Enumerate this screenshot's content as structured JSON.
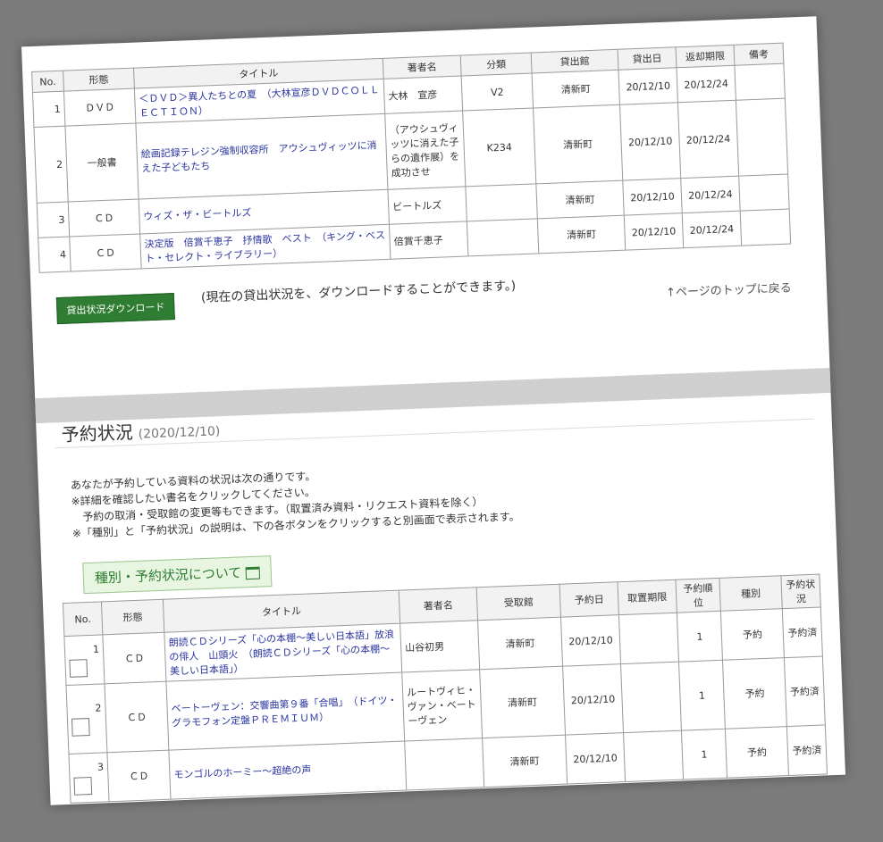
{
  "loan": {
    "headers": [
      "No.",
      "形態",
      "タイトル",
      "著者名",
      "分類",
      "貸出館",
      "貸出日",
      "返却期限",
      "備考"
    ],
    "rows": [
      {
        "no": "1",
        "format": "ＤＶＤ",
        "title": "＜ＤＶＤ＞異人たちとの夏　（大林宣彦ＤＶＤＣＯＬＬＥＣＴＩＯＮ）",
        "author": "大林　宣彦",
        "class": "V2",
        "branch": "清新町",
        "out": "20/12/10",
        "due": "20/12/24",
        "note": ""
      },
      {
        "no": "2",
        "format": "一般書",
        "title": "絵画記録テレジン強制収容所　アウシュヴィッツに消えた子どもたち",
        "author": "（アウシュヴィッツに消えた子らの遺作展）を成功させ",
        "class": "K234",
        "branch": "清新町",
        "out": "20/12/10",
        "due": "20/12/24",
        "note": ""
      },
      {
        "no": "3",
        "format": "ＣＤ",
        "title": "ウィズ・ザ・ビートルズ",
        "author": "ビートルズ",
        "class": "",
        "branch": "清新町",
        "out": "20/12/10",
        "due": "20/12/24",
        "note": ""
      },
      {
        "no": "4",
        "format": "ＣＤ",
        "title": "決定版　倍賞千恵子　抒情歌　ベスト　（キング・ベスト・セレクト・ライブラリー）",
        "author": "倍賞千恵子",
        "class": "",
        "branch": "清新町",
        "out": "20/12/10",
        "due": "20/12/24",
        "note": ""
      }
    ],
    "download_label": "貸出状況ダウンロード",
    "download_note": "(現在の貸出状況を、ダウンロードすることができます。)",
    "pagetop": "↑ページのトップに戻る"
  },
  "reserve": {
    "heading": "予約状況",
    "date": "(2020/12/10)",
    "notes": [
      "あなたが予約している資料の状況は次の通りです。",
      "※詳細を確認したい書名をクリックしてください。",
      "　予約の取消・受取館の変更等もできます。（取置済み資料・リクエスト資料を除く）",
      "※「種別」と「予約状況」の説明は、下の各ボタンをクリックすると別画面で表示されます。"
    ],
    "about_label": "種別・予約状況について",
    "headers": [
      "No.",
      "形態",
      "タイトル",
      "著者名",
      "受取館",
      "予約日",
      "取置期限",
      "予約順位",
      "種別",
      "予約状況"
    ],
    "rows": [
      {
        "no": "1",
        "format": "ＣＤ",
        "title": "朗読ＣＤシリーズ「心の本棚～美しい日本語」放浪の俳人　山頭火　（朗読ＣＤシリーズ「心の本棚～美しい日本語」）",
        "author": "山谷初男",
        "branch": "清新町",
        "date": "20/12/10",
        "hold": "",
        "rank": "1",
        "kind": "予約",
        "status": "予約済"
      },
      {
        "no": "2",
        "format": "ＣＤ",
        "title": "ベートーヴェン：交響曲第９番「合唱」　（ドイツ・グラモフォン定盤ＰＲＥＭＩＵＭ）",
        "author": "ルートヴィヒ・ヴァン・ベートーヴェン",
        "branch": "清新町",
        "date": "20/12/10",
        "hold": "",
        "rank": "1",
        "kind": "予約",
        "status": "予約済"
      },
      {
        "no": "3",
        "format": "ＣＤ",
        "title": "モンゴルのホーミー～超絶の声",
        "author": "",
        "branch": "清新町",
        "date": "20/12/10",
        "hold": "",
        "rank": "1",
        "kind": "予約",
        "status": "予約済"
      }
    ]
  }
}
